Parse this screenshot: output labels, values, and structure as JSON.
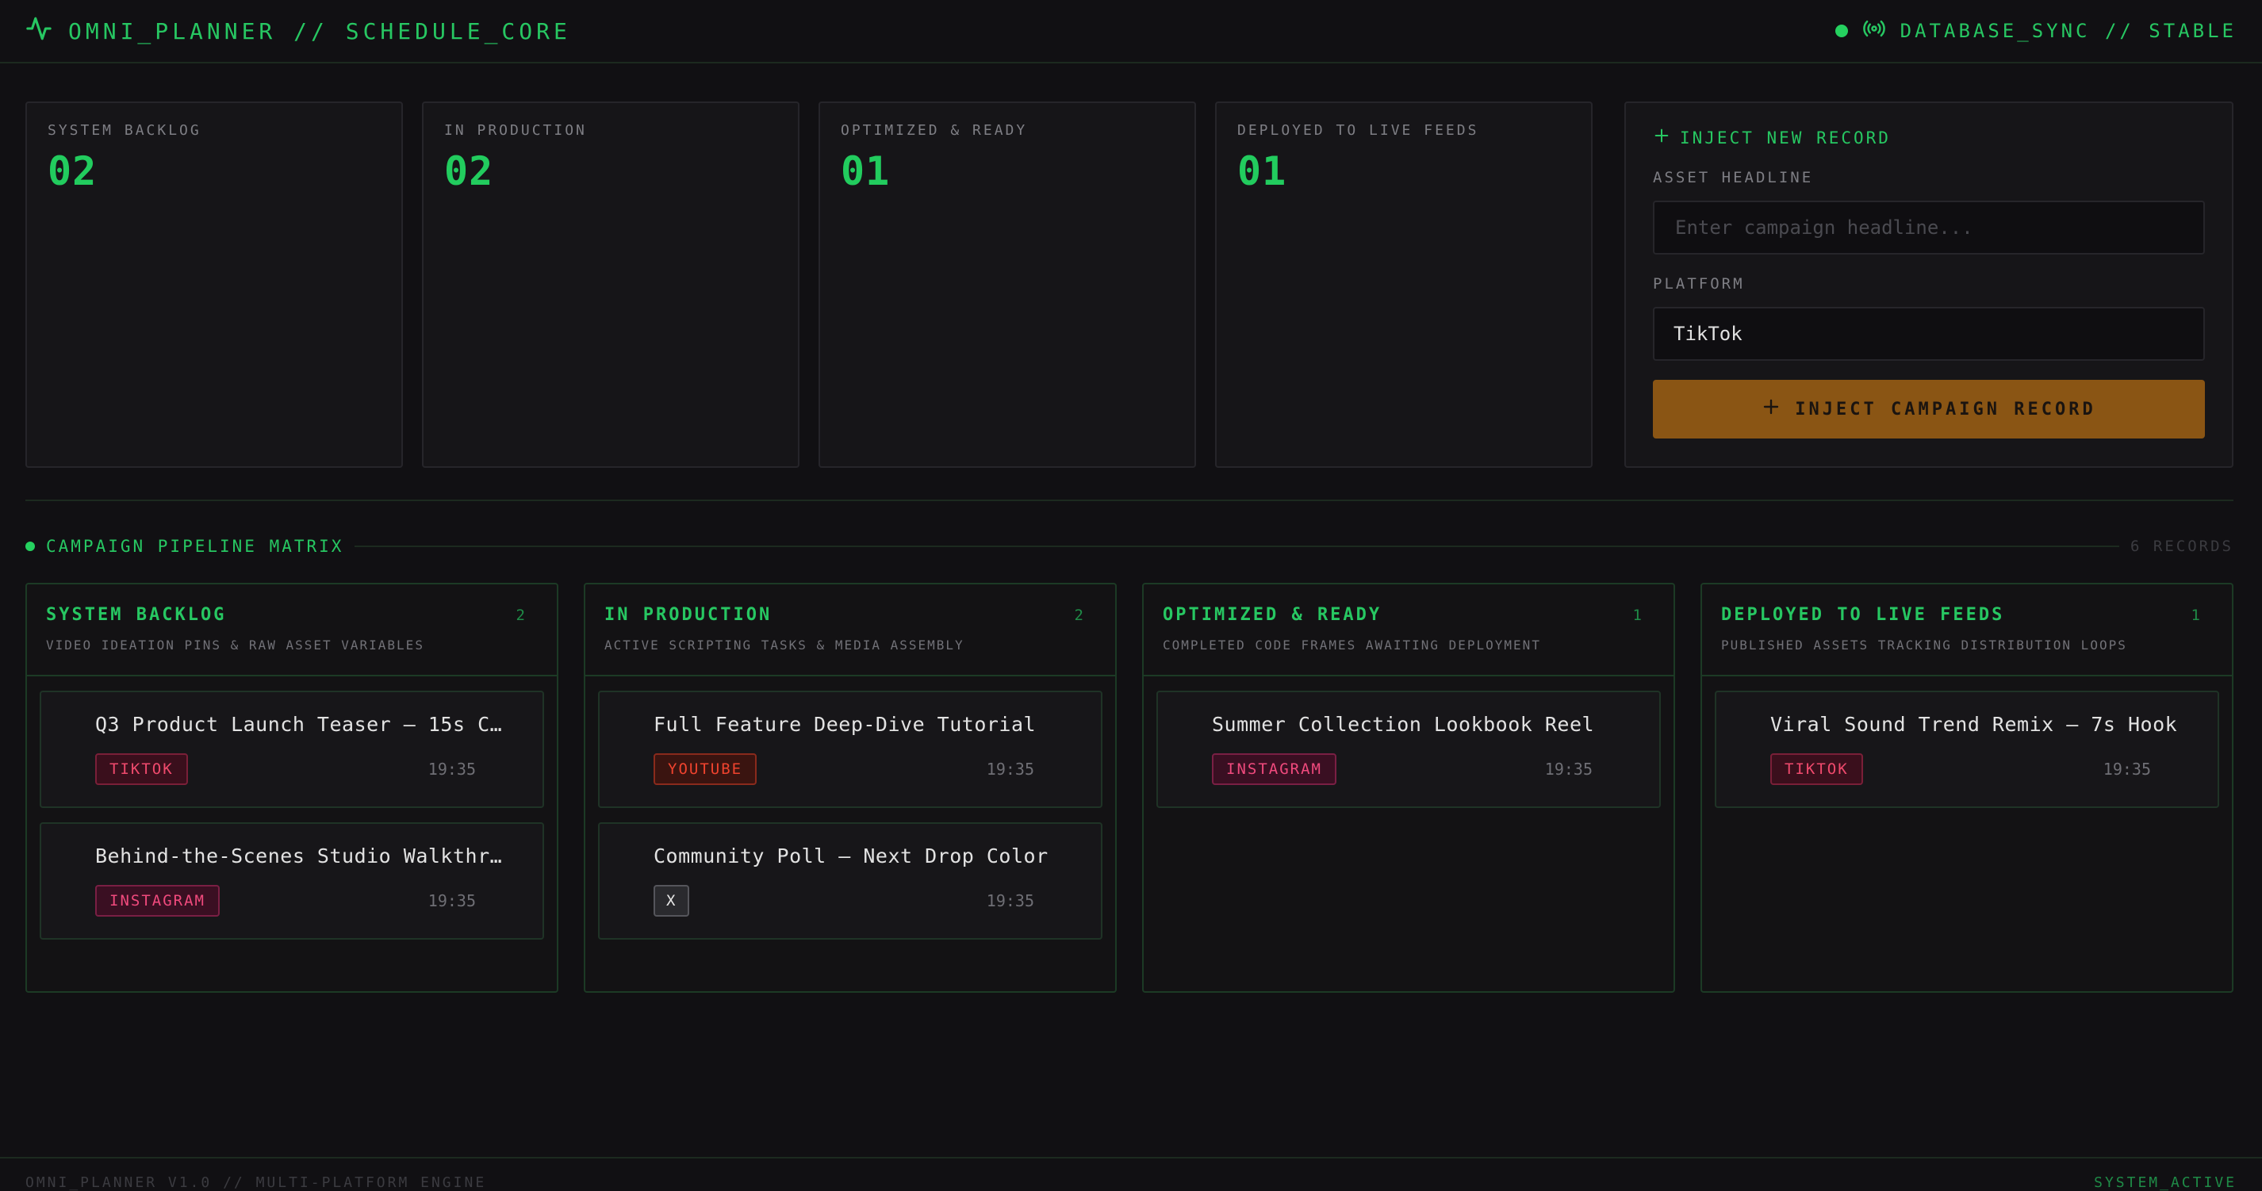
{
  "header": {
    "brand": "OMNI_PLANNER // SCHEDULE_CORE",
    "brand_icon": "activity-pulse-icon",
    "status_icon": "broadcast-signal-icon",
    "status": "DATABASE_SYNC // STABLE"
  },
  "stats": [
    {
      "label": "SYSTEM BACKLOG",
      "value": "02"
    },
    {
      "label": "IN PRODUCTION",
      "value": "02"
    },
    {
      "label": "OPTIMIZED & READY",
      "value": "01"
    },
    {
      "label": "DEPLOYED TO LIVE FEEDS",
      "value": "01"
    }
  ],
  "inject_form": {
    "title": "INJECT NEW RECORD",
    "headline_label": "ASSET HEADLINE",
    "headline_value": "",
    "headline_placeholder": "Enter campaign headline...",
    "platform_label": "PLATFORM",
    "platform_value": "TikTok",
    "submit_label": "INJECT CAMPAIGN RECORD"
  },
  "matrix": {
    "title": "CAMPAIGN PIPELINE MATRIX",
    "count": "6 RECORDS"
  },
  "columns": [
    {
      "title": "SYSTEM BACKLOG",
      "count": "2",
      "subtitle": "VIDEO IDEATION PINS & RAW ASSET VARIABLES",
      "cards": [
        {
          "title": "Q3 Product Launch Teaser — 15s C…",
          "platform": "TIKTOK",
          "time": "19:35"
        },
        {
          "title": "Behind-the-Scenes Studio Walkthr…",
          "platform": "INSTAGRAM",
          "time": "19:35"
        }
      ]
    },
    {
      "title": "IN PRODUCTION",
      "count": "2",
      "subtitle": "ACTIVE SCRIPTING TASKS & MEDIA ASSEMBLY",
      "cards": [
        {
          "title": "Full Feature Deep-Dive Tutorial",
          "platform": "YOUTUBE",
          "time": "19:35"
        },
        {
          "title": "Community Poll — Next Drop Color",
          "platform": "X",
          "time": "19:35"
        }
      ]
    },
    {
      "title": "OPTIMIZED & READY",
      "count": "1",
      "subtitle": "COMPLETED CODE FRAMES AWAITING DEPLOYMENT",
      "cards": [
        {
          "title": "Summer Collection Lookbook Reel",
          "platform": "INSTAGRAM",
          "time": "19:35"
        }
      ]
    },
    {
      "title": "DEPLOYED TO LIVE FEEDS",
      "count": "1",
      "subtitle": "PUBLISHED ASSETS TRACKING DISTRIBUTION LOOPS",
      "cards": [
        {
          "title": "Viral Sound Trend Remix — 7s Hook",
          "platform": "TIKTOK",
          "time": "19:35"
        }
      ]
    }
  ],
  "footer": {
    "left": "OMNI_PLANNER V1.0 // MULTI-PLATFORM ENGINE",
    "right": "SYSTEM_ACTIVE"
  },
  "colors": {
    "accent": "#27c762",
    "button": "#8a5514",
    "background": "#111013"
  }
}
